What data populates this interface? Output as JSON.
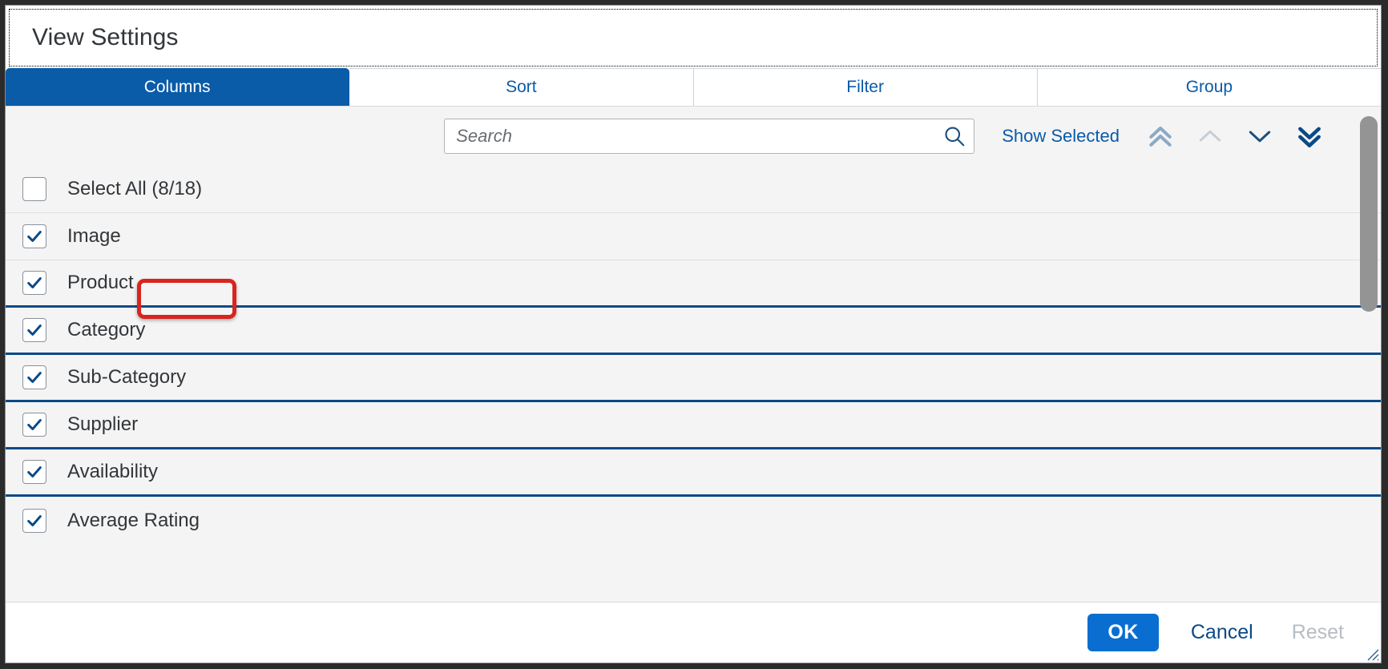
{
  "dialog": {
    "title": "View Settings"
  },
  "tabs": [
    {
      "label": "Columns",
      "active": true
    },
    {
      "label": "Sort",
      "active": false
    },
    {
      "label": "Filter",
      "active": false
    },
    {
      "label": "Group",
      "active": false
    }
  ],
  "toolbar": {
    "search": {
      "value": "",
      "placeholder": "Search",
      "icon": "search-icon"
    },
    "show_selected_label": "Show Selected",
    "nav_buttons": [
      {
        "name": "move-to-top-button",
        "icon": "double-chevron-up-icon",
        "state": "enabled",
        "color": "#8ca9c4"
      },
      {
        "name": "move-up-button",
        "icon": "chevron-up-icon",
        "state": "disabled",
        "color": "#c6ced6"
      },
      {
        "name": "move-down-button",
        "icon": "chevron-down-icon",
        "state": "enabled",
        "color": "#1b4f7e"
      },
      {
        "name": "move-to-bottom-button",
        "icon": "double-chevron-down-icon",
        "state": "enabled",
        "color": "#0a4a86"
      }
    ]
  },
  "select_all": {
    "label": "Select All (8/18)",
    "checked": false,
    "selected_count": 8,
    "total_count": 18,
    "annotated": true,
    "annotation_color": "#d9241f"
  },
  "columns": [
    {
      "label": "Image",
      "checked": true,
      "separator": "light"
    },
    {
      "label": "Product",
      "checked": true,
      "separator": "strong"
    },
    {
      "label": "Category",
      "checked": true,
      "separator": "strong"
    },
    {
      "label": "Sub-Category",
      "checked": true,
      "separator": "strong"
    },
    {
      "label": "Supplier",
      "checked": true,
      "separator": "strong"
    },
    {
      "label": "Availability",
      "checked": true,
      "separator": "strong"
    },
    {
      "label": "Average Rating",
      "checked": true,
      "separator": "none"
    }
  ],
  "scrollbar": {
    "name": "vertical-scrollbar",
    "thumb_top_pct": 2,
    "thumb_height_pct": 44
  },
  "footer": {
    "ok_label": "OK",
    "cancel_label": "Cancel",
    "reset_label": "Reset",
    "reset_disabled": true
  },
  "colors": {
    "accent": "#0a5ba8",
    "ok_button": "#0a6ed1",
    "link": "#0a4a86",
    "annotation": "#d9241f",
    "row_bg": "#f4f4f4",
    "separator_strong": "#0a4a86"
  }
}
